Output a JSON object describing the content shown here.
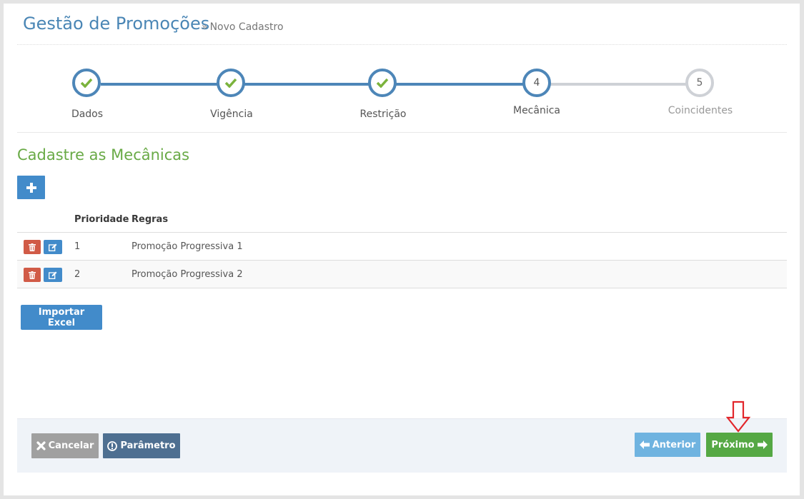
{
  "header": {
    "title": "Gestão de Promoções",
    "breadcrumb_sep": "»",
    "breadcrumb": "Novo Cadastro"
  },
  "wizard": {
    "steps": [
      {
        "number": "1",
        "label": "Dados",
        "state": "complete"
      },
      {
        "number": "2",
        "label": "Vigência",
        "state": "complete"
      },
      {
        "number": "3",
        "label": "Restrição",
        "state": "complete"
      },
      {
        "number": "4",
        "label": "Mecânica",
        "state": "active"
      },
      {
        "number": "5",
        "label": "Coincidentes",
        "state": "pending"
      }
    ],
    "colors": {
      "active": "#4d86b8",
      "pending": "#ced1d6",
      "check": "#7bb33c"
    }
  },
  "section": {
    "title": "Cadastre as Mecânicas",
    "add_icon": "plus-icon"
  },
  "table": {
    "columns": [
      "Prioridade",
      "Regras"
    ],
    "rows": [
      {
        "priority": "1",
        "rule": "Promoção Progressiva 1"
      },
      {
        "priority": "2",
        "rule": "Promoção Progressiva 2"
      }
    ]
  },
  "import_button": "Importar Excel",
  "footer": {
    "cancel": "Cancelar",
    "parameter": "Parâmetro",
    "previous": "Anterior",
    "next": "Próximo"
  }
}
